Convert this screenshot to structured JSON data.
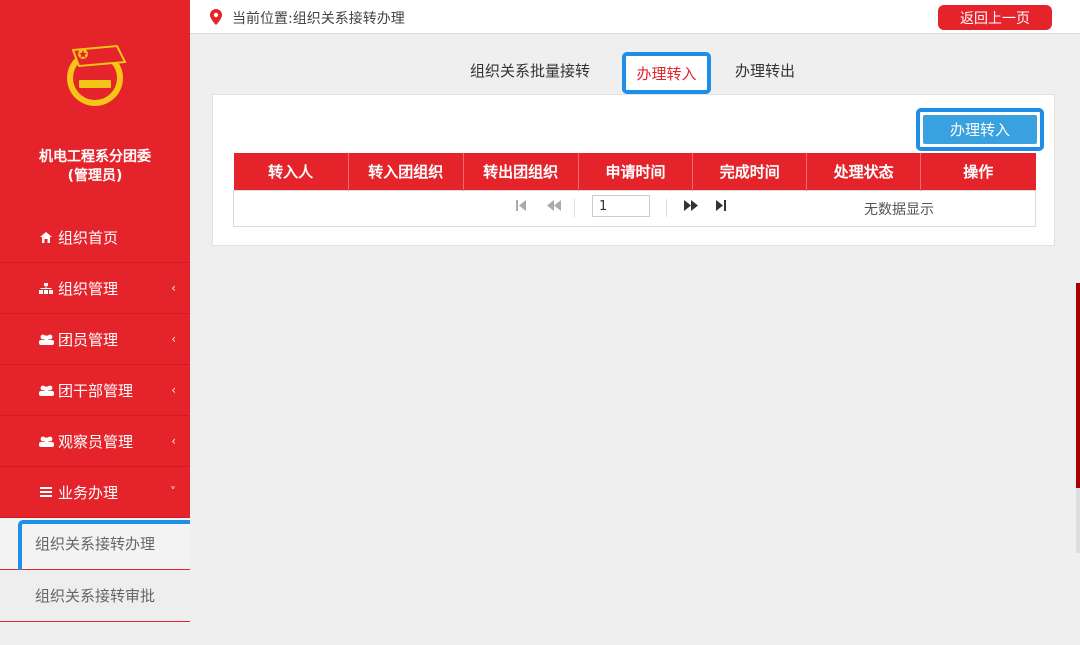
{
  "sidebar": {
    "org_title_line1": "机电工程系分团委",
    "org_title_line2": "(管理员)",
    "menu": [
      {
        "icon": "home-icon",
        "label": "组织首页"
      },
      {
        "icon": "sitemap-icon",
        "label": "组织管理",
        "chevron": "‹"
      },
      {
        "icon": "group-icon",
        "label": "团员管理",
        "chevron": "‹"
      },
      {
        "icon": "group-icon",
        "label": "团干部管理",
        "chevron": "‹"
      },
      {
        "icon": "group-icon",
        "label": "观察员管理",
        "chevron": "‹"
      },
      {
        "icon": "list-icon",
        "label": "业务办理",
        "chevron": "˅"
      }
    ],
    "submenu": [
      {
        "label": "组织关系接转办理"
      },
      {
        "label": "组织关系接转审批"
      }
    ]
  },
  "topbar": {
    "location": "当前位置:组织关系接转办理",
    "back_label": "返回上一页"
  },
  "tabs": {
    "batch": "组织关系批量接转",
    "in": "办理转入",
    "out": "办理转出"
  },
  "panel": {
    "action_label": "办理转入",
    "columns": [
      "转入人",
      "转入团组织",
      "转出团组织",
      "申请时间",
      "完成时间",
      "处理状态",
      "操作"
    ],
    "pager": {
      "page_value": "1",
      "empty_text": "无数据显示"
    }
  },
  "colors": {
    "brand_red": "#e4232b",
    "highlight_blue": "#1e8ee6",
    "button_blue": "#3aa1e0"
  }
}
